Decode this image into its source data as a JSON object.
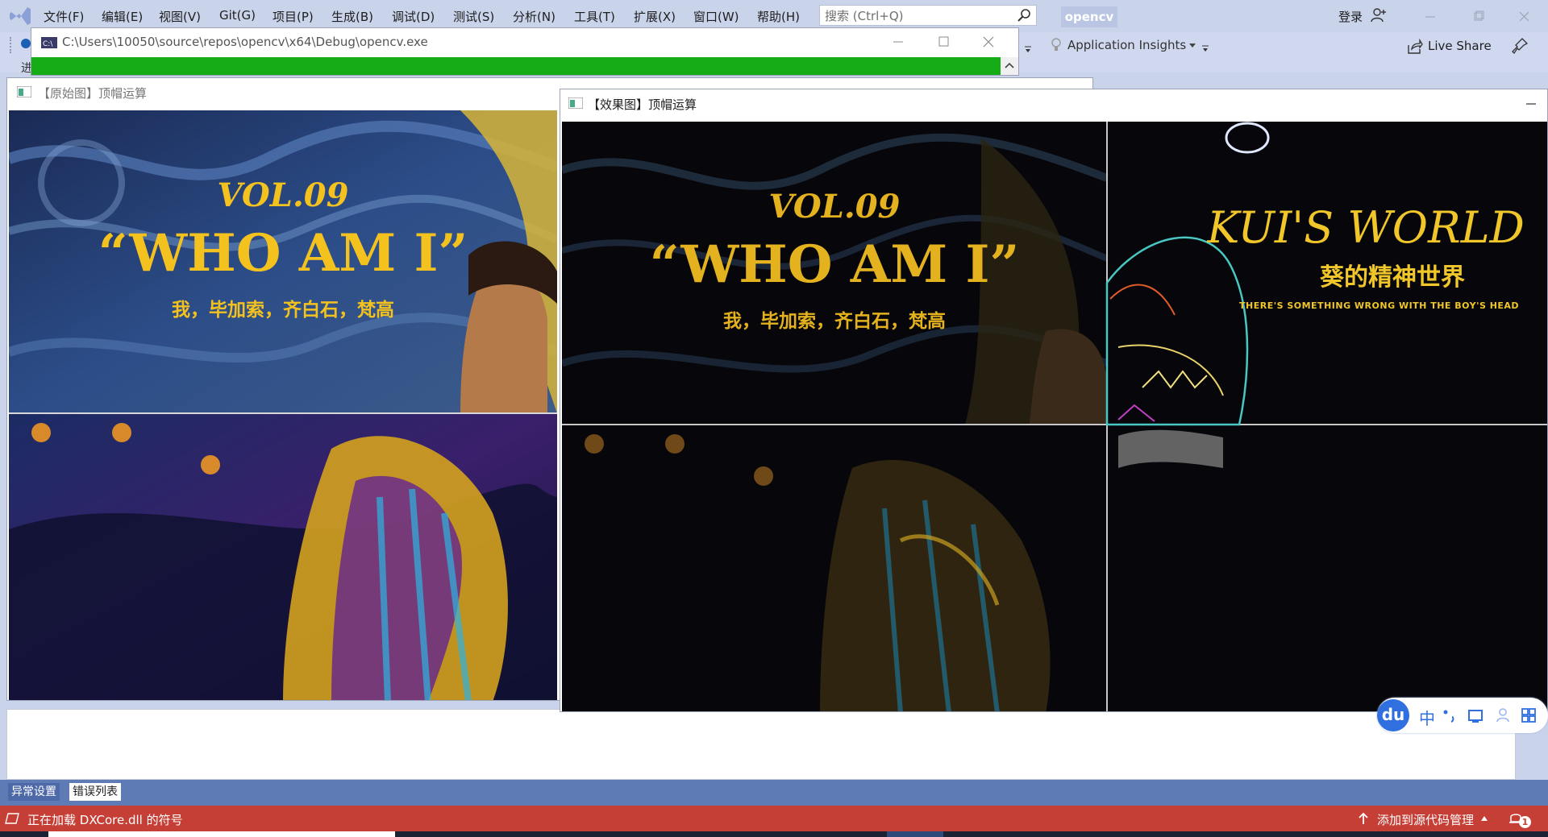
{
  "menubar": {
    "items": [
      "文件(F)",
      "编辑(E)",
      "视图(V)",
      "Git(G)",
      "项目(P)",
      "生成(B)",
      "调试(D)",
      "测试(S)",
      "分析(N)",
      "工具(T)",
      "扩展(X)",
      "窗口(W)",
      "帮助(H)"
    ],
    "search_placeholder": "搜索 (Ctrl+Q)",
    "solution_name": "opencv",
    "login_label": "登录"
  },
  "toolbar": {
    "app_insights_label": "Application Insights",
    "live_share_label": "Live Share",
    "partial_left_label": "进"
  },
  "console_window": {
    "title": "C:\\Users\\10050\\source\\repos\\opencv\\x64\\Debug\\opencv.exe"
  },
  "original_window": {
    "title": "【原始图】顶帽运算",
    "top_panel": {
      "vol": "VOL.09",
      "headline": "“WHO AM I”",
      "subtitle": "我，毕加索，齐白石，梵高"
    }
  },
  "result_window": {
    "title": "【效果图】顶帽运算",
    "top_left_panel": {
      "vol": "VOL.09",
      "headline": "“WHO AM I”",
      "subtitle": "我，毕加索，齐白石，梵高"
    },
    "top_right_panel": {
      "headline": "KUI'S WORLD",
      "subtitle": "葵的精神世界",
      "tagline": "THERE'S SOMETHING WRONG WITH THE BOY'S HEAD"
    }
  },
  "bottom_tabs": [
    "异常设置",
    "错误列表"
  ],
  "status_bar": {
    "message": "正在加载 DXCore.dll 的符号",
    "source_control_label": "添加到源代码管理",
    "notification_count": "1"
  },
  "ime": {
    "logo": "du",
    "mode": "中"
  },
  "colors": {
    "vs_background": "#c9d3ea",
    "status_bar": "#c53f36",
    "bottom_tab_bar": "#5f7bb6",
    "console_progress": "#16ac16",
    "poster_text_gold": "#f4c21f",
    "ime_blue": "#2f6fe0"
  }
}
